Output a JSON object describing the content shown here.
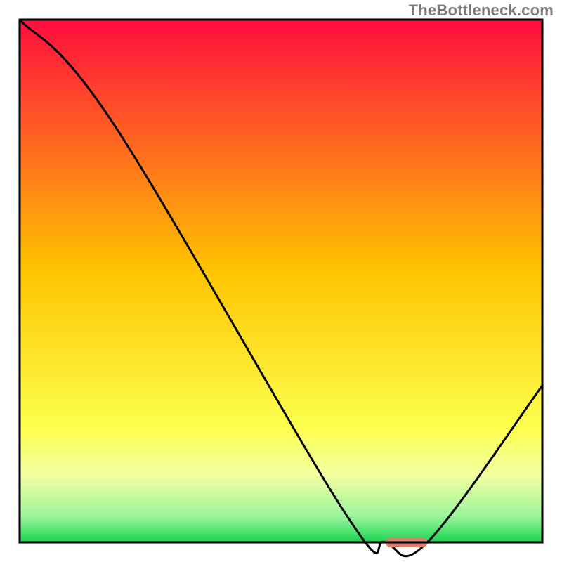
{
  "watermark": "TheBottleneck.com",
  "chart_data": {
    "type": "line",
    "title": "",
    "xlabel": "",
    "ylabel": "",
    "xlim": [
      0,
      100
    ],
    "ylim": [
      0,
      100
    ],
    "x": [
      0,
      18,
      62,
      70,
      78,
      100
    ],
    "values": [
      100,
      80,
      6,
      0,
      0,
      30
    ],
    "marker": {
      "x0": 70,
      "x1": 78,
      "y": 0,
      "color": "#d9816f"
    },
    "gradient_stops": [
      {
        "offset": 0.0,
        "color": "#ff0d3e"
      },
      {
        "offset": 0.48,
        "color": "#ffc400"
      },
      {
        "offset": 0.78,
        "color": "#fcff4d"
      },
      {
        "offset": 0.87,
        "color": "#f3ffa0"
      },
      {
        "offset": 0.95,
        "color": "#9cf59c"
      },
      {
        "offset": 1.0,
        "color": "#17d54f"
      }
    ],
    "frame_color": "#000000",
    "curve_color": "#000000"
  }
}
